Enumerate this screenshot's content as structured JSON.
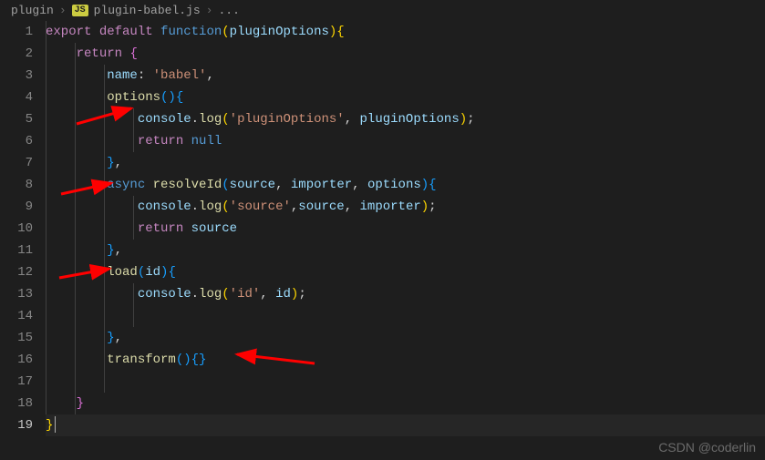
{
  "breadcrumb": {
    "folder": "plugin",
    "file": "plugin-babel.js",
    "more": "..."
  },
  "lines": [
    "1",
    "2",
    "3",
    "4",
    "5",
    "6",
    "7",
    "8",
    "9",
    "10",
    "11",
    "12",
    "13",
    "14",
    "15",
    "16",
    "17",
    "18",
    "19"
  ],
  "code": {
    "l1": {
      "export": "export",
      "default": "default",
      "function": "function",
      "param": "pluginOptions"
    },
    "l2": {
      "return": "return"
    },
    "l3": {
      "name": "name",
      "val": "'babel'"
    },
    "l4": {
      "options": "options"
    },
    "l5": {
      "console": "console",
      "log": "log",
      "str": "'pluginOptions'",
      "arg": "pluginOptions"
    },
    "l6": {
      "return": "return",
      "null": "null"
    },
    "l8": {
      "async": "async",
      "resolveId": "resolveId",
      "p1": "source",
      "p2": "importer",
      "p3": "options"
    },
    "l9": {
      "console": "console",
      "log": "log",
      "str": "'source'",
      "a1": "source",
      "a2": "importer"
    },
    "l10": {
      "return": "return",
      "source": "source"
    },
    "l12": {
      "load": "load",
      "id": "id"
    },
    "l13": {
      "console": "console",
      "log": "log",
      "str": "'id'",
      "arg": "id"
    },
    "l16": {
      "transform": "transform"
    }
  },
  "watermark": "CSDN @coderlin"
}
